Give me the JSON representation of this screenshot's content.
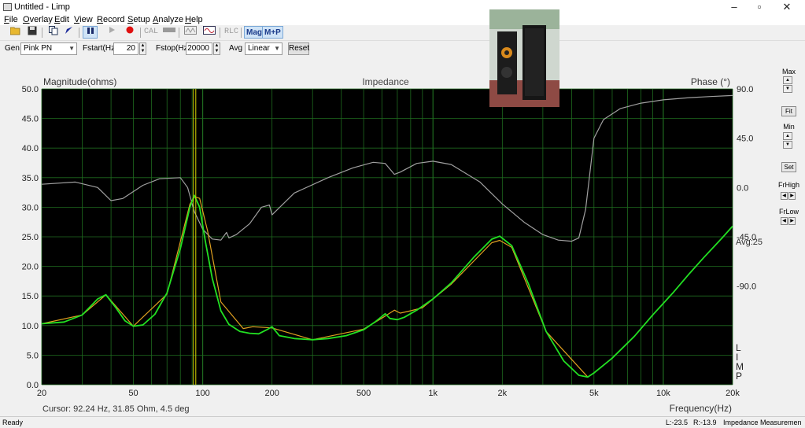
{
  "window": {
    "title": "Untitled - Limp",
    "controls": {
      "minimize": "–",
      "maximize": "▫",
      "close": "✕"
    }
  },
  "menu": [
    "File",
    "Overlay",
    "Edit",
    "View",
    "Record",
    "Setup",
    "Analyze",
    "Help"
  ],
  "toolbar": {
    "icons": [
      "open-folder-icon",
      "save-icon",
      "copy-icon",
      "cursor-icon",
      "pause-icon",
      "play-icon",
      "record-icon"
    ],
    "cal_label": "CAL",
    "rlc_label": "RLC",
    "mag_label": "Mag",
    "mp_label": "M+P"
  },
  "genbar": {
    "gen_label": "Gen",
    "gen_value": "Pink PN",
    "fstart_label": "Fstart(Hz)",
    "fstart_value": "20",
    "fstop_label": "Fstop(Hz)",
    "fstop_value": "20000",
    "avg_label": "Avg",
    "avg_value": "Linear",
    "reset_label": "Reset"
  },
  "right_panel": {
    "max_label": "Max",
    "fit_label": "Fit",
    "min_label": "Min",
    "set_label": "Set",
    "frhigh_label": "FrHigh",
    "frlow_label": "FrLow"
  },
  "status": {
    "ready": "Ready",
    "left_level": "L:-23.5",
    "right_level": "R:-13.9",
    "mode": "Impedance Measuremen"
  },
  "chart_data": {
    "type": "line",
    "title": "Impedance",
    "ylabel": "Magnitude(ohms)",
    "y2label": "Phase (°)",
    "xlabel": "Frequency(Hz)",
    "xscale": "log",
    "xlim": [
      20,
      20000
    ],
    "ylim": [
      0,
      50
    ],
    "y2lim": [
      -180,
      90
    ],
    "xticks": [
      20,
      50,
      100,
      200,
      500,
      1000,
      2000,
      5000,
      10000,
      20000
    ],
    "xtick_labels": [
      "20",
      "50",
      "100",
      "200",
      "500",
      "1k",
      "2k",
      "5k",
      "10k",
      "20k"
    ],
    "yticks": [
      0,
      5,
      10,
      15,
      20,
      25,
      30,
      35,
      40,
      45,
      50
    ],
    "ytick_labels": [
      "0.0",
      "5.0",
      "10.0",
      "15.0",
      "20.0",
      "25.0",
      "30.0",
      "35.0",
      "40.0",
      "45.0",
      "50.0"
    ],
    "y2ticks": [
      90,
      45,
      0,
      -45,
      -90
    ],
    "y2tick_labels": [
      "90.0",
      "45.0",
      "0.0",
      "-45.0",
      "-90.0"
    ],
    "grid": true,
    "cursor_text": "Cursor: 92.24 Hz, 31.85 Ohm, 4.5 deg",
    "cursor_x": 92.24,
    "avg_text": "Avg:25",
    "side_letters": [
      "L",
      "I",
      "M",
      "P"
    ],
    "colors": {
      "background": "#000000",
      "grid": "#1f6b1f",
      "magnitude": "#22e022",
      "overlay": "#e0a020",
      "phase": "#a0a0a0",
      "cursor": "#d6d600"
    },
    "series": [
      {
        "role": "magnitude",
        "x": [
          20,
          25,
          30,
          35,
          38,
          42,
          46,
          50,
          55,
          62,
          70,
          80,
          88,
          92,
          97,
          103,
          110,
          120,
          130,
          145,
          160,
          175,
          190,
          200,
          215,
          250,
          300,
          350,
          420,
          500,
          560,
          620,
          650,
          700,
          750,
          850,
          1000,
          1200,
          1500,
          1800,
          1950,
          2200,
          2600,
          3100,
          3700,
          4300,
          4700,
          5000,
          6000,
          7500,
          9000,
          11000,
          13000,
          15000,
          18000,
          20000
        ],
        "y": [
          10.3,
          10.6,
          11.8,
          14.5,
          15.2,
          13.0,
          10.8,
          9.9,
          10.1,
          11.9,
          15.5,
          23.0,
          30.0,
          32.0,
          30.0,
          24.0,
          18.0,
          12.5,
          10.2,
          9.0,
          8.7,
          8.6,
          9.3,
          9.8,
          8.3,
          7.8,
          7.6,
          7.8,
          8.3,
          9.3,
          10.6,
          12.0,
          11.2,
          11.0,
          11.4,
          12.6,
          14.5,
          17.2,
          21.5,
          24.6,
          25.1,
          23.5,
          17.0,
          9.0,
          4.0,
          1.6,
          1.3,
          2.0,
          4.5,
          8.2,
          11.8,
          15.5,
          18.8,
          21.5,
          24.8,
          26.8
        ]
      },
      {
        "role": "overlay",
        "x": [
          20,
          30,
          38,
          50,
          70,
          88,
          92,
          97,
          105,
          120,
          150,
          165,
          200,
          300,
          500,
          620,
          680,
          720,
          800,
          900,
          1200,
          1800,
          1950,
          2200,
          3100,
          4700
        ],
        "y": [
          10.3,
          11.8,
          15.2,
          9.9,
          15.3,
          30.5,
          31.8,
          31.5,
          26.0,
          14.0,
          9.5,
          9.8,
          9.6,
          7.6,
          9.4,
          11.6,
          12.6,
          12.1,
          12.5,
          13.0,
          17.0,
          24.0,
          24.4,
          23.2,
          9.0,
          1.3
        ]
      },
      {
        "role": "phase",
        "x": [
          20,
          28,
          35,
          40,
          45,
          55,
          65,
          80,
          86,
          92,
          100,
          110,
          120,
          127,
          130,
          140,
          160,
          180,
          195,
          200,
          250,
          350,
          450,
          550,
          620,
          680,
          720,
          850,
          1000,
          1200,
          1600,
          2000,
          2500,
          3000,
          3500,
          4000,
          4300,
          4600,
          5000,
          5500,
          6500,
          8000,
          10000,
          13000,
          16000,
          20000
        ],
        "y": [
          3,
          5,
          0,
          -12,
          -10,
          2,
          8,
          9,
          0,
          -22,
          -38,
          -47,
          -48,
          -41,
          -46,
          -43,
          -33,
          -18,
          -16,
          -25,
          -5,
          9,
          18,
          23,
          22,
          12,
          14,
          22,
          24,
          21,
          5,
          -15,
          -32,
          -43,
          -48,
          -49,
          -46,
          -20,
          45,
          62,
          72,
          77,
          80,
          82,
          83,
          84
        ]
      }
    ]
  }
}
